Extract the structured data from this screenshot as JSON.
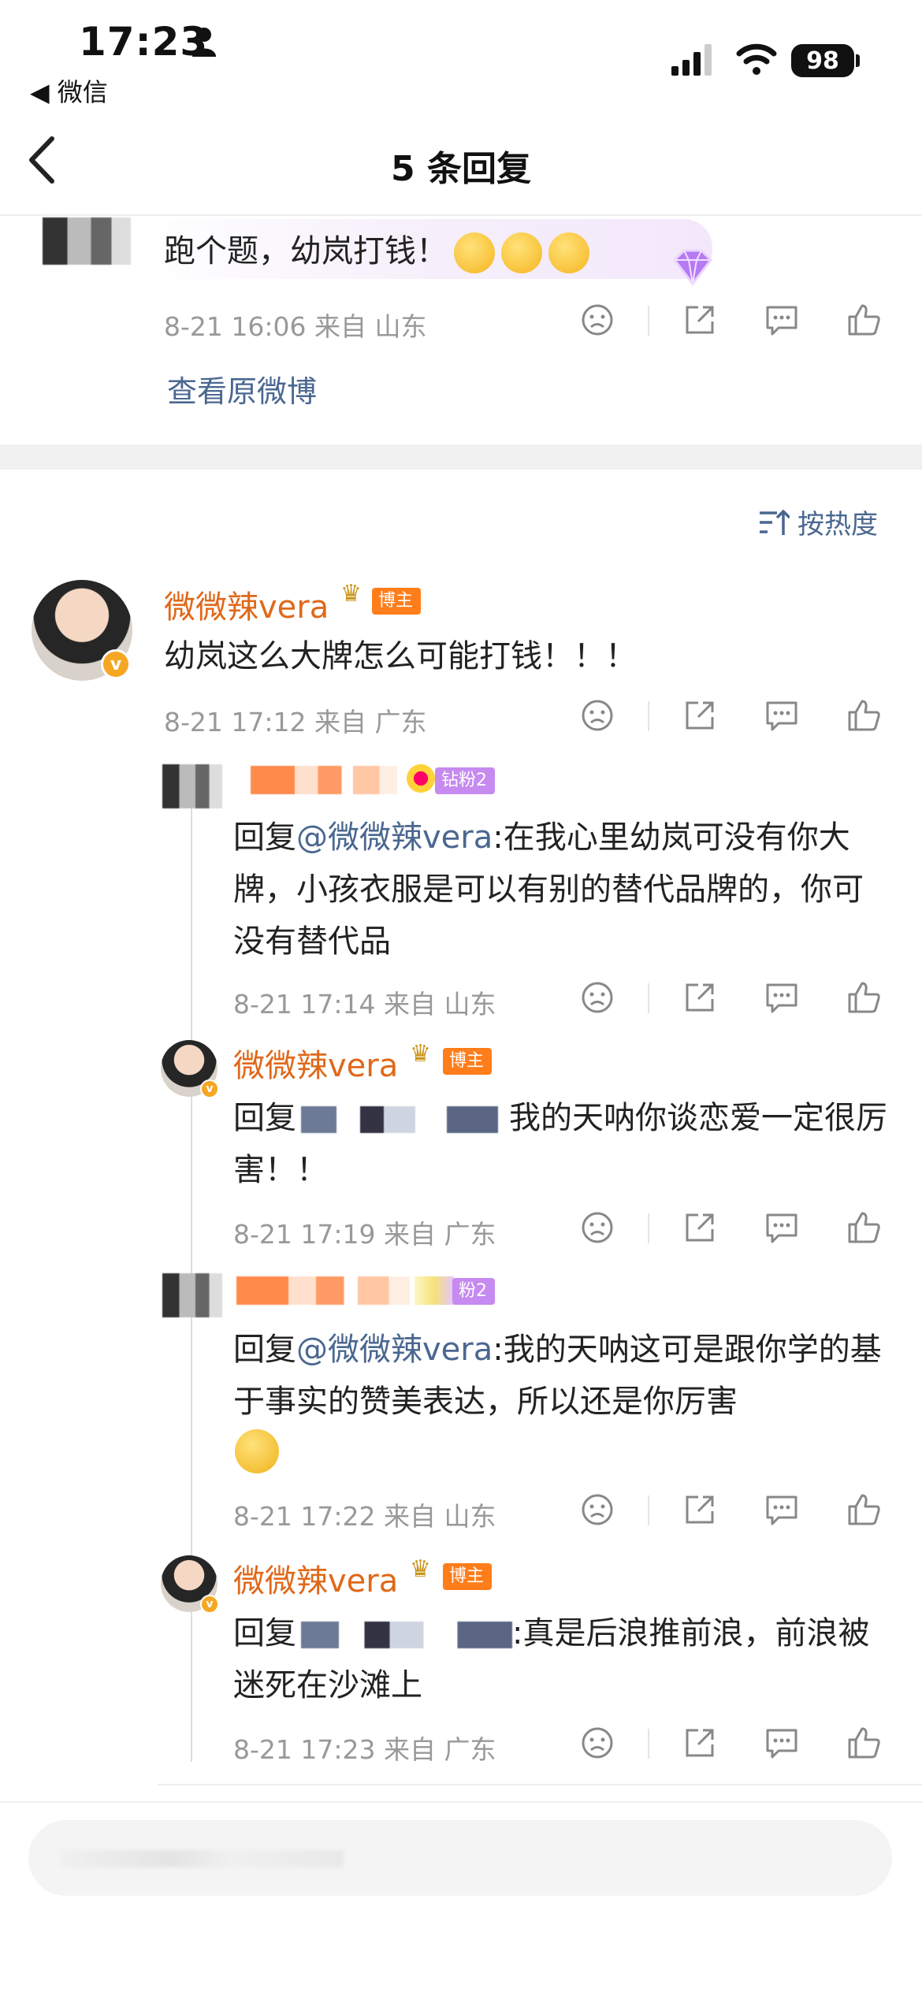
{
  "status_bar": {
    "time": "17:23",
    "back_app": "◀ 微信",
    "battery": "98"
  },
  "nav": {
    "title": "5 条回复"
  },
  "root_comment": {
    "text": "跑个题，幼岚打钱！",
    "meta": "8-21 16:06 来自 山东",
    "view_original": "查看原微博"
  },
  "sort_label": "按热度",
  "main_comment": {
    "name": "微微辣vera",
    "tag": "博主",
    "text": "幼岚这么大牌怎么可能打钱！！！",
    "meta": "8-21 17:12 来自 广东"
  },
  "replies": [
    {
      "tag": "钻粉2",
      "prefix": "回复",
      "mention": "@微微辣vera",
      "text": ":在我心里幼岚可没有你大牌，小孩衣服是可以有别的替代品牌的，你可没有替代品",
      "meta": "8-21 17:14 来自 山东"
    },
    {
      "name": "微微辣vera",
      "tag": "博主",
      "prefix": "回复",
      "text": "我的天呐你谈恋爱一定很厉害！！",
      "meta": "8-21 17:19 来自 广东"
    },
    {
      "tag": "粉2",
      "prefix": "回复",
      "mention": "@微微辣vera",
      "text": ":我的天呐这可是跟你学的基于事实的赞美表达，所以还是你厉害",
      "meta": "8-21 17:22 来自 山东"
    },
    {
      "name": "微微辣vera",
      "tag": "博主",
      "prefix": "回复",
      "text": ":真是后浪推前浪，前浪被迷死在沙滩上",
      "meta": "8-21 17:23 来自 广东"
    }
  ],
  "colors": {
    "name_orange": "#e0681a",
    "link_blue": "#4a6790",
    "tag_orange": "#ff7d1a",
    "tag_purple": "#c68af0"
  }
}
